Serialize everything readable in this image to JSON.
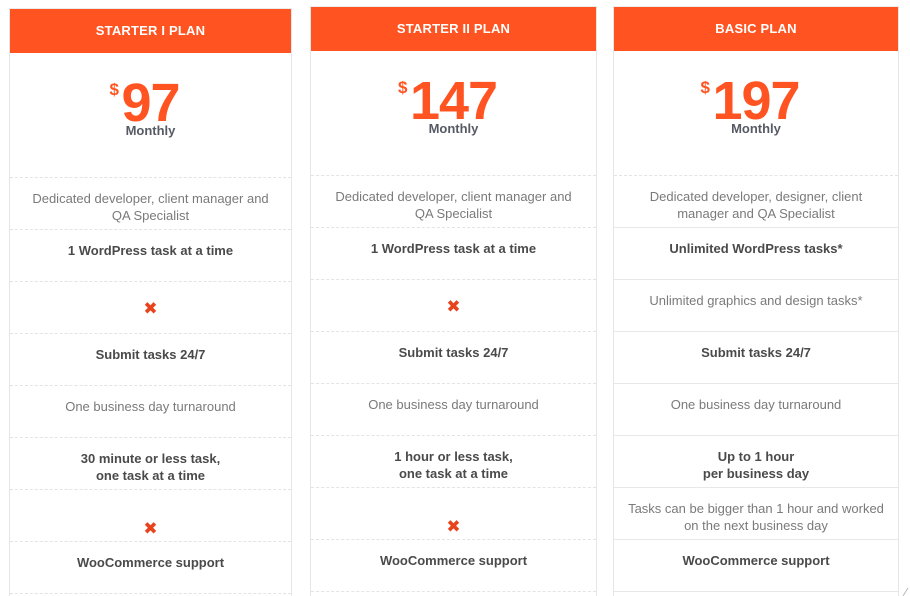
{
  "brand_color": "#ff5421",
  "plans": [
    {
      "name": "STARTER I PLAN",
      "currency": "$",
      "price": "97",
      "period": "Monthly",
      "features": [
        {
          "text": "Dedicated developer, client manager and QA Specialist",
          "style": "normal"
        },
        {
          "text": "1 WordPress task at a time",
          "style": "bold"
        },
        {
          "text": "",
          "icon": "x-icon",
          "style": "icon"
        },
        {
          "text": "Submit tasks 24/7",
          "style": "bold"
        },
        {
          "text": "One business day turnaround",
          "style": "normal"
        },
        {
          "text": "30 minute or less task,\none task at a time",
          "style": "bold"
        },
        {
          "text": "",
          "icon": "x-icon",
          "style": "icon"
        },
        {
          "text": "WooCommerce support",
          "style": "bold"
        }
      ]
    },
    {
      "name": "STARTER II PLAN",
      "currency": "$",
      "price": "147",
      "period": "Monthly",
      "features": [
        {
          "text": "Dedicated developer, client manager and QA Specialist",
          "style": "normal"
        },
        {
          "text": "1 WordPress task at a time",
          "style": "bold"
        },
        {
          "text": "",
          "icon": "x-icon",
          "style": "icon"
        },
        {
          "text": "Submit tasks 24/7",
          "style": "bold"
        },
        {
          "text": "One business day turnaround",
          "style": "normal"
        },
        {
          "text": "1 hour or less task,\none task at a time",
          "style": "bold"
        },
        {
          "text": "",
          "icon": "x-icon",
          "style": "icon"
        },
        {
          "text": "WooCommerce support",
          "style": "bold"
        }
      ]
    },
    {
      "name": "BASIC PLAN",
      "currency": "$",
      "price": "197",
      "period": "Monthly",
      "features": [
        {
          "text": "Dedicated developer, designer, client manager and QA Specialist",
          "style": "normal"
        },
        {
          "text": "Unlimited WordPress tasks*",
          "style": "bold"
        },
        {
          "text": "Unlimited graphics and design tasks*",
          "style": "normal"
        },
        {
          "text": "Submit tasks 24/7",
          "style": "bold"
        },
        {
          "text": "One business day turnaround",
          "style": "normal"
        },
        {
          "text": "Up to 1 hour\nper business day",
          "style": "bold"
        },
        {
          "text": "Tasks can be bigger than 1 hour and worked on the next business day",
          "style": "normal"
        },
        {
          "text": "WooCommerce support",
          "style": "bold"
        }
      ]
    }
  ]
}
